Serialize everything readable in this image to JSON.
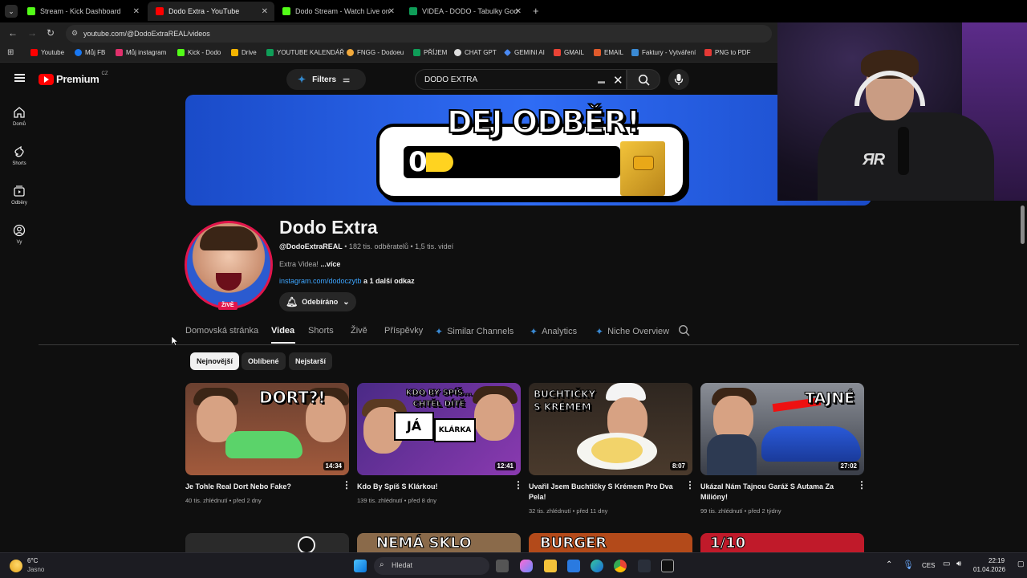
{
  "browser": {
    "tabs": [
      {
        "title": "Stream - Kick Dashboard",
        "color": "#53fc18"
      },
      {
        "title": "Dodo Extra - YouTube",
        "color": "#ff0000"
      },
      {
        "title": "Dodo Stream - Watch Live on K",
        "color": "#53fc18"
      },
      {
        "title": "VIDEA - DODO - Tabulky Googl",
        "color": "#0f9d58"
      }
    ],
    "url": "youtube.com/@DodoExtraREAL/videos",
    "bookmarks": [
      {
        "label": "Youtube",
        "color": "#ff0000"
      },
      {
        "label": "Můj FB",
        "color": "#1877f2"
      },
      {
        "label": "Můj instagram",
        "color": "#e1306c"
      },
      {
        "label": "Kick - Dodo",
        "color": "#53fc18"
      },
      {
        "label": "Drive",
        "color": "#f4b400"
      },
      {
        "label": "YOUTUBE KALENDÁŘ",
        "color": "#0f9d58"
      },
      {
        "label": "FNGG - Dodoeu",
        "color": "#f2a93b"
      },
      {
        "label": "PŘÍJEM",
        "color": "#0f9d58"
      },
      {
        "label": "CHAT GPT",
        "color": "#dddddd"
      },
      {
        "label": "GEMINI AI",
        "color": "#4a8af4"
      },
      {
        "label": "GMAIL",
        "color": "#ea4335"
      },
      {
        "label": "EMAIL",
        "color": "#e05a2b"
      },
      {
        "label": "Faktury - Vytváření",
        "color": "#3a8ad4"
      },
      {
        "label": "PNG to PDF",
        "color": "#e53935"
      }
    ]
  },
  "youtube": {
    "logo_text": "Premium",
    "region": "CZ",
    "filters_label": "Filters",
    "search_value": "DODO EXTRA",
    "sidebar": [
      {
        "label": "Domů",
        "icon": "home-icon"
      },
      {
        "label": "Shorts",
        "icon": "shorts-icon"
      },
      {
        "label": "Odběry",
        "icon": "subscriptions-icon"
      },
      {
        "label": "Vy",
        "icon": "profile-icon"
      }
    ],
    "banner": {
      "title": "DEJ ODBĚR!",
      "count": "0"
    },
    "channel": {
      "name": "Dodo Extra",
      "handle": "@DodoExtraREAL",
      "stats": " • 182 tis. odběratelů • 1,5 tis. videí",
      "description": "Extra Videa! ",
      "more": "...více",
      "link": "instagram.com/dodoczytb",
      "other_links": " a 1 další odkaz",
      "live_badge": "ŽIVĚ",
      "subscribe_label": "Odebíráno"
    },
    "tabs": [
      {
        "label": "Domovská stránka",
        "active": false
      },
      {
        "label": "Videa",
        "active": true
      },
      {
        "label": "Shorts",
        "active": false
      },
      {
        "label": "Živě",
        "active": false
      },
      {
        "label": "Příspěvky",
        "active": false
      },
      {
        "label": "Similar Channels",
        "active": false
      },
      {
        "label": "Analytics",
        "active": false
      },
      {
        "label": "Niche Overview",
        "active": false
      }
    ],
    "chips": [
      {
        "label": "Nejnovější",
        "selected": true
      },
      {
        "label": "Oblíbené",
        "selected": false
      },
      {
        "label": "Nejstarší",
        "selected": false
      }
    ],
    "videos": [
      {
        "title": "Je Tohle Real Dort Nebo Fake?",
        "views": "40 tis. zhlédnutí",
        "age": "před 2 dny",
        "duration": "14:34",
        "thumb_text": "DORT?!",
        "bg": "#7a3a2a"
      },
      {
        "title": "Kdo By Spíš S Klárkou!",
        "views": "139 tis. zhlédnutí",
        "age": "před 8 dny",
        "duration": "12:41",
        "thumb_text": "KDO BY SPÍŠ... CHTĚL DÍTĚ",
        "thumb_sub1": "JÁ",
        "thumb_sub2": "KLÁRKA",
        "bg": "#5a2c8c"
      },
      {
        "title": "Uvařil Jsem Buchtičky S Krémem Pro Dva Pela!",
        "views": "32 tis. zhlédnutí",
        "age": "před 11 dny",
        "duration": "8:07",
        "thumb_text": "BUCHTIČKY S KRÉMEM",
        "bg": "#3a2c24"
      },
      {
        "title": "Ukázal Nám Tajnou Garáž S Autama Za Milióny!",
        "views": "99 tis. zhlédnutí",
        "age": "před 2 týdny",
        "duration": "27:02",
        "thumb_text": "TAJNÉ",
        "bg": "#4a4f5a"
      }
    ],
    "next_row": [
      {
        "thumb_text": "",
        "bg": "#2a2a2a"
      },
      {
        "thumb_text": "NEMÁ SKLO",
        "bg": "#8a6a4a"
      },
      {
        "thumb_text": "BURGER",
        "bg": "#b34a1a"
      },
      {
        "thumb_text": "1/10",
        "bg": "#c01a2a"
      }
    ]
  },
  "taskbar": {
    "weather_temp": "6°C",
    "weather_desc": "Jasno",
    "search_placeholder": "Hledat",
    "language": "CES",
    "time": "22:19",
    "date": "01.04.2026"
  }
}
